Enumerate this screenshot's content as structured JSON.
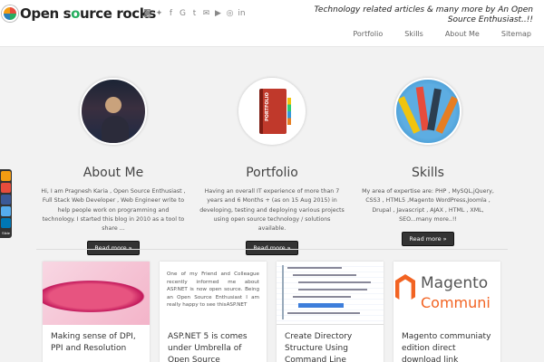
{
  "header": {
    "logo_text_1": "Open s",
    "logo_text_o": "o",
    "logo_text_2": "urce rocks",
    "tagline": "Technology related articles & many more by An Open Source Enthusiast..!!",
    "social_icons": [
      "rss-icon",
      "twitter-icon",
      "facebook-icon",
      "google-plus-icon",
      "tumblr-icon",
      "email-icon",
      "youtube-icon",
      "github-icon",
      "linkedin-icon"
    ],
    "social_glyphs": [
      "◙",
      "✦",
      "f",
      "G",
      "t",
      "✉",
      "▶",
      "◎",
      "in"
    ],
    "nav": [
      "Portfolio",
      "Skills",
      "About Me",
      "Sitemap"
    ]
  },
  "sharebar": {
    "label": "Slide"
  },
  "features": [
    {
      "title": "About Me",
      "text": "Hi, I am Pragnesh Karia , Open Source Enthusiast , Full Stack Web Developer , Web Engineer write to help people work on programming and technology. I started this blog in 2010 as a tool to share ...",
      "button": "Read more »"
    },
    {
      "title": "Portfolio",
      "image_text": "PORTFOLIO",
      "text": "Having an overall IT experience of more than 7 years and 6 Months + (as on 15 Aug 2015) in developing, testing and deploying various projects using open source technology / solutions available.",
      "button": "Read more »"
    },
    {
      "title": "Skills",
      "text": "My area of expertise are: PHP , MySQL,jQuery, CSS3 , HTML5 ,Magento WordPress,Joomla , Drupal , Javascript , AJAX , HTML , XML, SEO...many more..!!",
      "button": "Read more »"
    }
  ],
  "posts": [
    {
      "title": "Making sense of DPI, PPI and Resolution"
    },
    {
      "title": "ASP.NET 5 is comes under Umbrella of Open Source",
      "snippet": "One of my Friend and Colleague recently informed me about ASP.NET is now open source. Being an Open Source Enthusiast I am really happy to see thisASP.NET"
    },
    {
      "title": "Create Directory Structure Using Command Line"
    },
    {
      "title": "Magento communiaty edition direct download link",
      "image_text": "Magento",
      "image_text2": "Communi"
    }
  ],
  "colors": {
    "accent_dark": "#333333",
    "background": "#f2f2f2",
    "magento_orange": "#f26322"
  }
}
